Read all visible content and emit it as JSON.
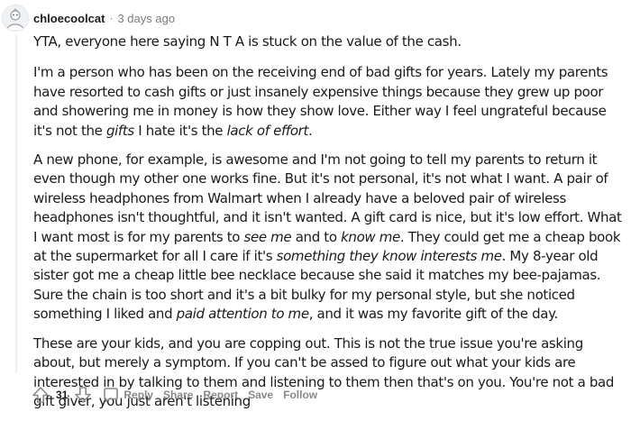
{
  "comment": {
    "username": "chloecoolcat",
    "separator": "·",
    "timestamp": "3 days ago",
    "paragraphs": {
      "p1": "YTA, everyone here saying N T A is stuck on the value of the cash.",
      "p2_a": "I'm a person who has been on the receiving end of bad gifts for years. Lately my parents have resorted to cash gifts or just insanely expensive things because they grew up poor and showering me in money is how they show love. Either way I feel ungrateful because it's not the ",
      "p2_em1": "gifts",
      "p2_b": " I hate it's the ",
      "p2_em2": "lack of effort",
      "p2_c": ".",
      "p3_a": "A new phone, for example, is awesome and I'm not going to tell my parents to return it even though my other one works fine. But it's not personal, it's not what I want. A pair of wireless headphones from Walmart when I already have a beloved pair of wireless headphones isn't thoughtful, and it isn't wanted. A gift card is nice, but it's low effort. What I want most is for my parents to ",
      "p3_em1": "see me",
      "p3_b": " and to ",
      "p3_em2": "know me",
      "p3_c": ". They could get me a cheap book at the supermarket for all I care if it's ",
      "p3_em3": "something they know interests me",
      "p3_d": ". My 8-year old sister got me a cheap little bee necklace because she said it matches my bee-pajamas. Sure the chain is too short and it's a bit bulky for my personal style, but she noticed something I liked and ",
      "p3_em4": "paid attention to me",
      "p3_e": ", and it was my favorite gift of the day.",
      "p4": "These are your kids, and you are copping out. This is not the true issue you're asking about, but merely a symptom. If you can't be assed to figure out what your kids are interested in by talking to them and listening to them then that's on you. You're not a bad gift giver, you just aren't listening"
    }
  },
  "actions": {
    "score": "31",
    "reply": "Reply",
    "share": "Share",
    "report": "Report",
    "save": "Save",
    "follow": "Follow"
  },
  "icons": {
    "upvote": "upvote-arrow-icon",
    "downvote": "downvote-arrow-icon",
    "reply": "chat-bubble-icon",
    "avatar": "default-avatar-icon"
  },
  "colors": {
    "meta_gray": "#7c7c7c",
    "action_gray": "#878a8c",
    "text": "#1a1a1b",
    "thread_line": "#edeff1"
  }
}
